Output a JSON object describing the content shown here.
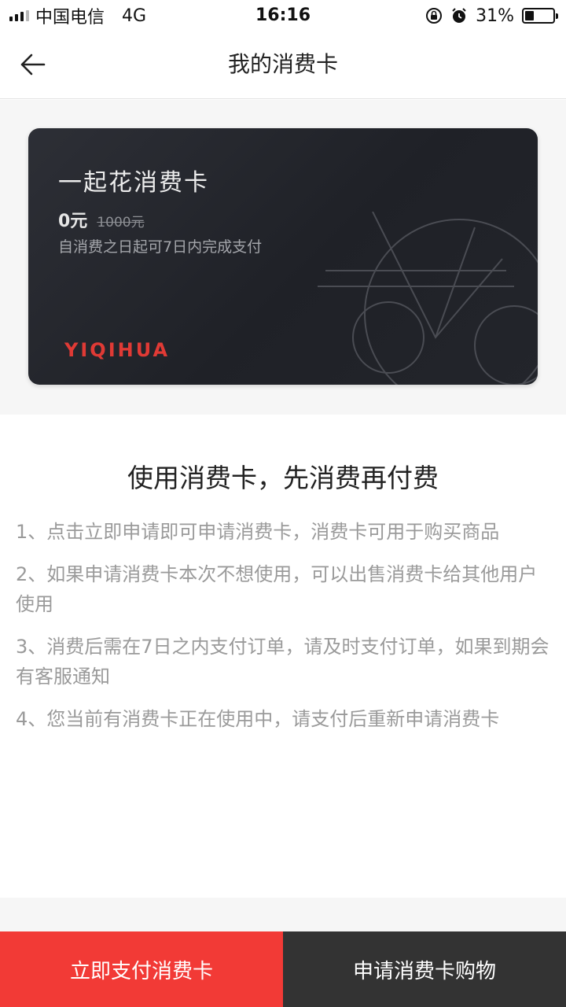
{
  "status_bar": {
    "carrier": "中国电信",
    "network": "4G",
    "time": "16:16",
    "battery": "31%",
    "battery_level": 0.31
  },
  "nav": {
    "title": "我的消费卡"
  },
  "card": {
    "name": "一起花消费卡",
    "price_now": "0元",
    "price_original": "1000元",
    "description": "自消费之日起可7日内完成支付",
    "brand": "YIQIHUA"
  },
  "info": {
    "title": "使用消费卡，先消费再付费",
    "rules": [
      "1、点击立即申请即可申请消费卡，消费卡可用于购买商品",
      "2、如果申请消费卡本次不想使用，可以出售消费卡给其他用户使用",
      "3、消费后需在7日之内支付订单，请及时支付订单，如果到期会有客服通知",
      "4、您当前有消费卡正在使用中，请支付后重新申请消费卡"
    ]
  },
  "buttons": {
    "pay_label": "立即支付消费卡",
    "apply_label": "申请消费卡购物"
  },
  "colors": {
    "primary_red": "#f23a36",
    "dark_button": "#333333",
    "brand_red": "#e03a35"
  },
  "icons": {
    "back": "arrow-left-icon",
    "lock": "orientation-lock-icon",
    "alarm": "alarm-icon"
  }
}
